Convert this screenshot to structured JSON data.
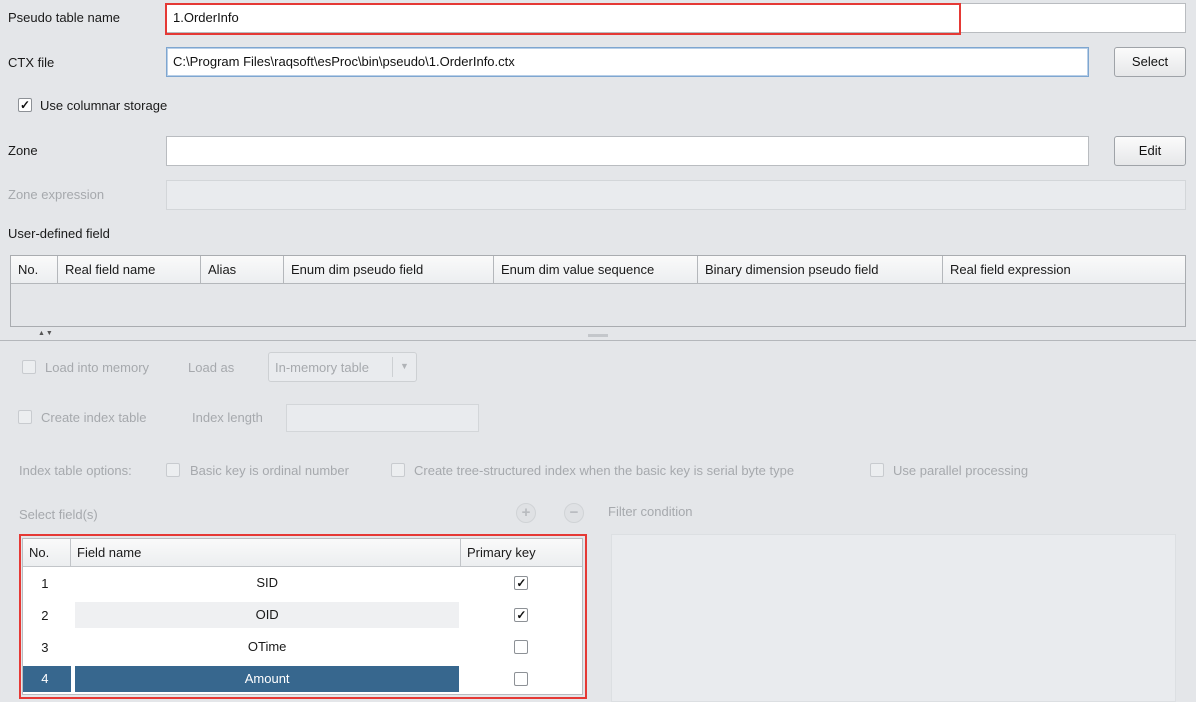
{
  "pseudo": {
    "label": "Pseudo table name",
    "value": "1.OrderInfo"
  },
  "ctx": {
    "label": "CTX file",
    "value": "C:\\Program Files\\raqsoft\\esProc\\bin\\pseudo\\1.OrderInfo.ctx",
    "button": "Select"
  },
  "columnar": {
    "label": "Use columnar storage",
    "checked": true
  },
  "zone": {
    "label": "Zone",
    "value": "",
    "button": "Edit"
  },
  "zone_expression": {
    "label": "Zone expression",
    "value": ""
  },
  "user_defined": {
    "label": "User-defined field",
    "columns": [
      "No.",
      "Real field name",
      "Alias",
      "Enum dim pseudo field",
      "Enum dim value sequence",
      "Binary dimension pseudo field",
      "Real field expression"
    ]
  },
  "splitter": {
    "arrows": "▲▼"
  },
  "load": {
    "label": "Load into memory",
    "load_as_label": "Load as",
    "load_as_value": "In-memory table",
    "index_label": "Create index table",
    "index_length_label": "Index length"
  },
  "index_options": {
    "label": "Index table options:",
    "opt1": "Basic key is ordinal number",
    "opt2": "Create tree-structured index when the basic key is serial byte type",
    "opt3": "Use parallel processing"
  },
  "select_fields": {
    "label": "Select field(s)",
    "columns": [
      "No.",
      "Field name",
      "Primary key"
    ],
    "rows": [
      {
        "no": "1",
        "name": "SID",
        "primary": true
      },
      {
        "no": "2",
        "name": "OID",
        "primary": true
      },
      {
        "no": "3",
        "name": "OTime",
        "primary": false
      },
      {
        "no": "4",
        "name": "Amount",
        "primary": false
      }
    ]
  },
  "filter": {
    "label": "Filter condition",
    "value": ""
  },
  "colors": {
    "selection": "#37678e",
    "highlight_box": "#e53935",
    "background": "#e4e6e9"
  }
}
